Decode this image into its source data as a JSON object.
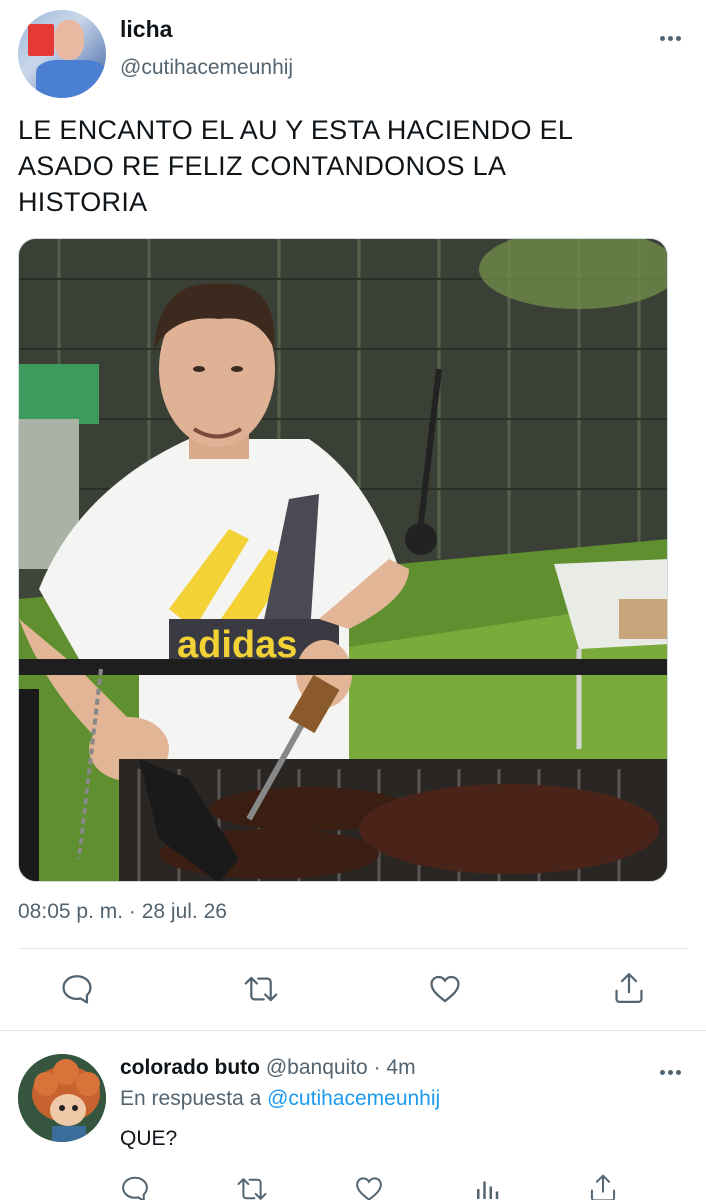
{
  "tweet": {
    "display_name": "licha",
    "handle": "@cutihacemeunhij",
    "text": "LE ENCANTO EL AU Y ESTA HACIENDO EL ASADO RE FELIZ CONTANDONOS LA HISTORIA",
    "text_lines": [
      "LE ENCANTO EL AU Y ESTA HACIENDO EL",
      "ASADO RE FELIZ CONTANDONOS LA",
      "HISTORIA"
    ],
    "timestamp": "08:05 p. m. · 28 jul. 26",
    "shirt_print": "adidas",
    "icons": {
      "more": "more-horizontal-icon",
      "reply": "reply-icon",
      "retweet": "retweet-icon",
      "like": "heart-icon",
      "share": "share-icon"
    }
  },
  "reply": {
    "display_name": "colorado buto",
    "handle_time": "@banquito · 4m",
    "reply_prefix": "En respuesta a",
    "reply_mention": "@cutihacemeunhij",
    "text": "QUE?",
    "icons": [
      "reply-icon",
      "retweet-icon",
      "heart-icon",
      "analytics-icon",
      "share-icon"
    ]
  },
  "colors": {
    "text_primary": "#0f1419",
    "text_secondary": "#536471",
    "link": "#1d9bf0",
    "divider": "#e1e8ed"
  }
}
